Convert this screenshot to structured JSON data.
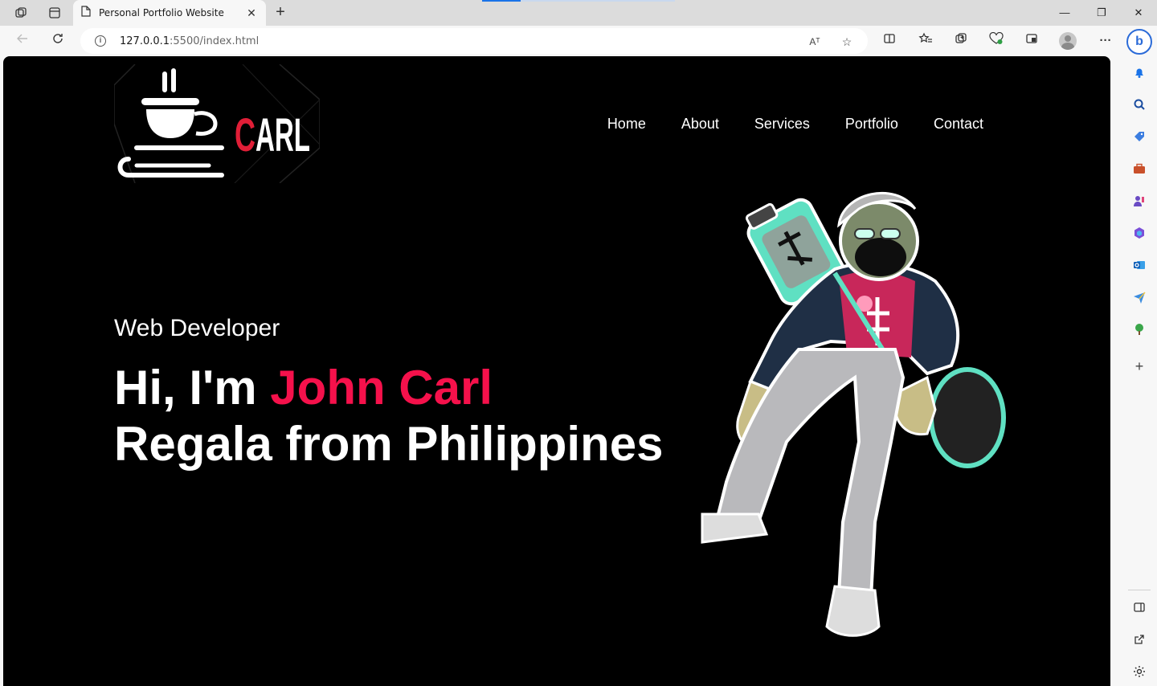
{
  "browser": {
    "tab_title": "Personal Portfolio Website",
    "tab_close": "✕",
    "new_tab": "+",
    "url_host": "127.0.0.1",
    "url_path": ":5500/index.html",
    "read_aloud": "Aᵀ",
    "minimize": "—",
    "restore": "❐",
    "close": "✕",
    "bing_label": "b"
  },
  "site": {
    "logo_text_first": "C",
    "logo_text_rest": "ARL",
    "nav": [
      "Home",
      "About",
      "Services",
      "Portfolio",
      "Contact"
    ],
    "role": "Web Developer",
    "greeting": "Hi, I'm ",
    "name_highlight": "John Carl",
    "headline_line2": "Regala from Philippines"
  },
  "colors": {
    "accent": "#f5114b",
    "background": "#000000",
    "text": "#ffffff"
  }
}
